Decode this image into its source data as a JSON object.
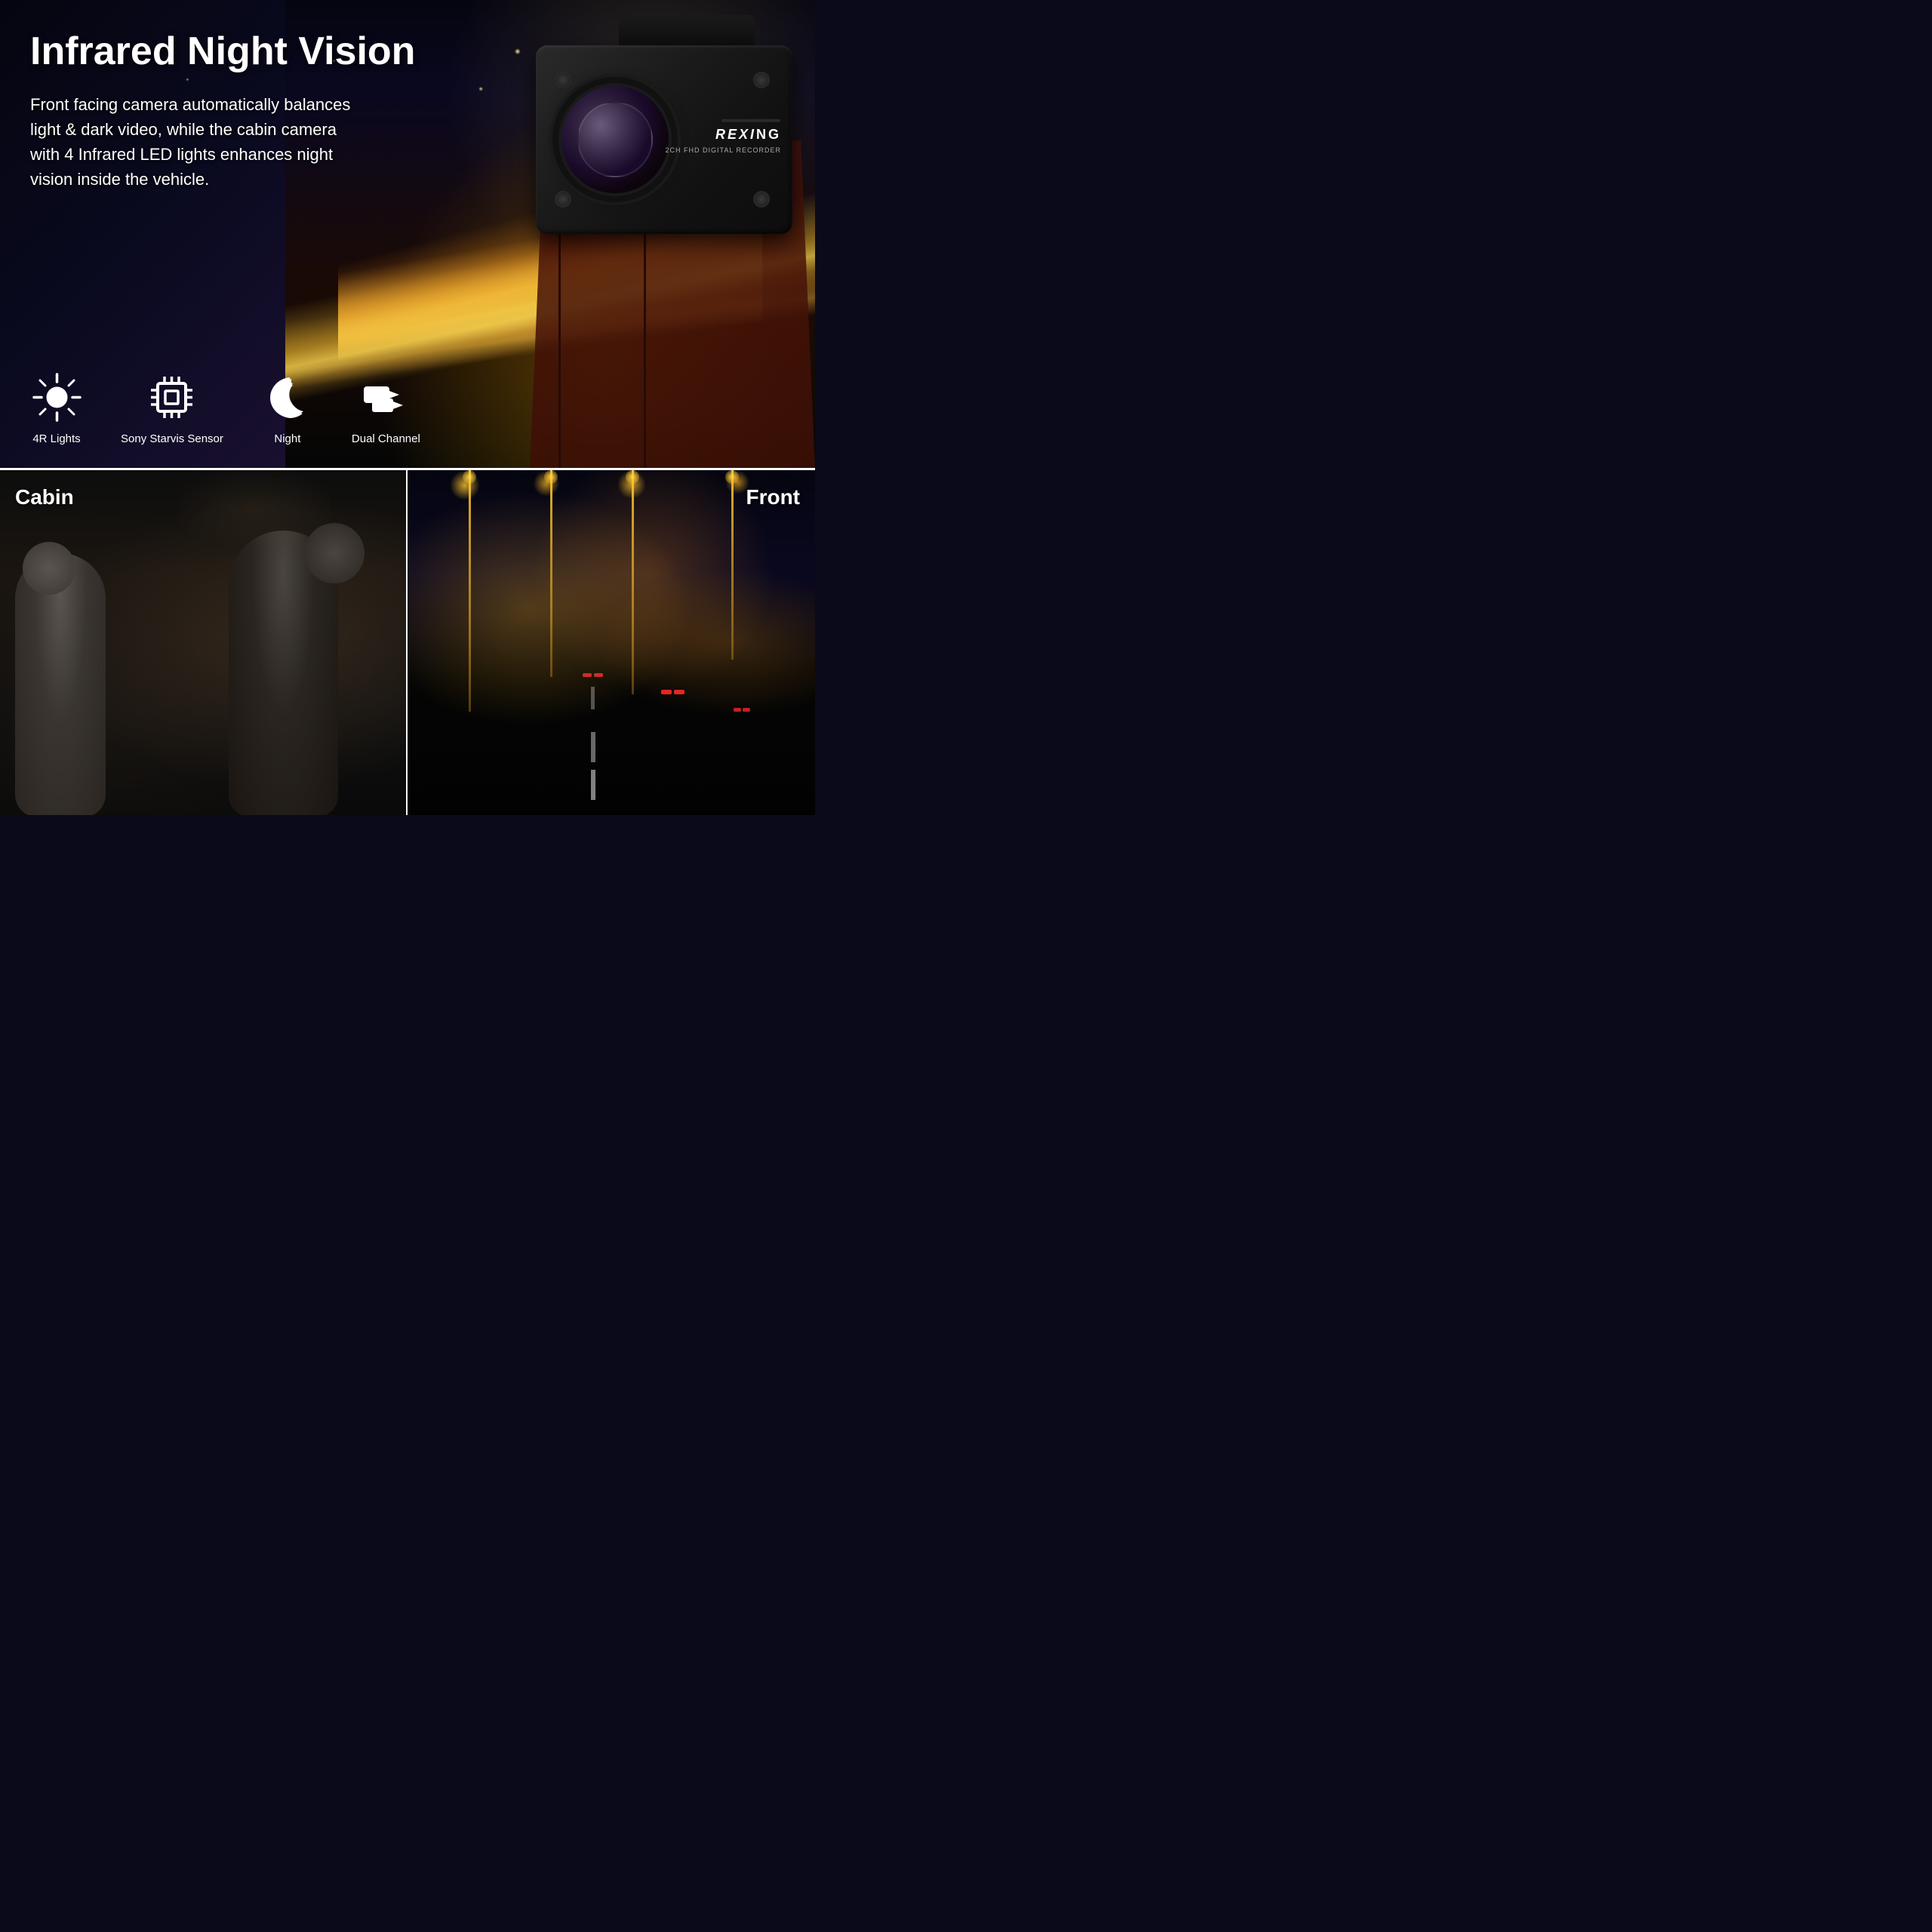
{
  "header": {
    "title": "Infrared Night Vision",
    "description": "Front facing camera automatically balances light & dark video, while the cabin camera with 4 Infrared LED lights enhances night vision inside the vehicle."
  },
  "brand": {
    "name": "REXiNG",
    "model": "2CH FHD DIGITAL RECORDER"
  },
  "features": [
    {
      "id": "4r-lights",
      "icon": "sun",
      "label": "4R Lights"
    },
    {
      "id": "sony-starvis",
      "icon": "chip",
      "label": "Sony Starvis Sensor"
    },
    {
      "id": "night",
      "icon": "moon",
      "label": "Night"
    },
    {
      "id": "dual-channel",
      "icon": "dual-camera",
      "label": "Dual Channel"
    }
  ],
  "panels": {
    "cabin": {
      "label": "Cabin"
    },
    "front": {
      "label": "Front"
    }
  },
  "colors": {
    "background": "#0a0a1a",
    "text": "#ffffff",
    "accent": "#ffb830"
  }
}
